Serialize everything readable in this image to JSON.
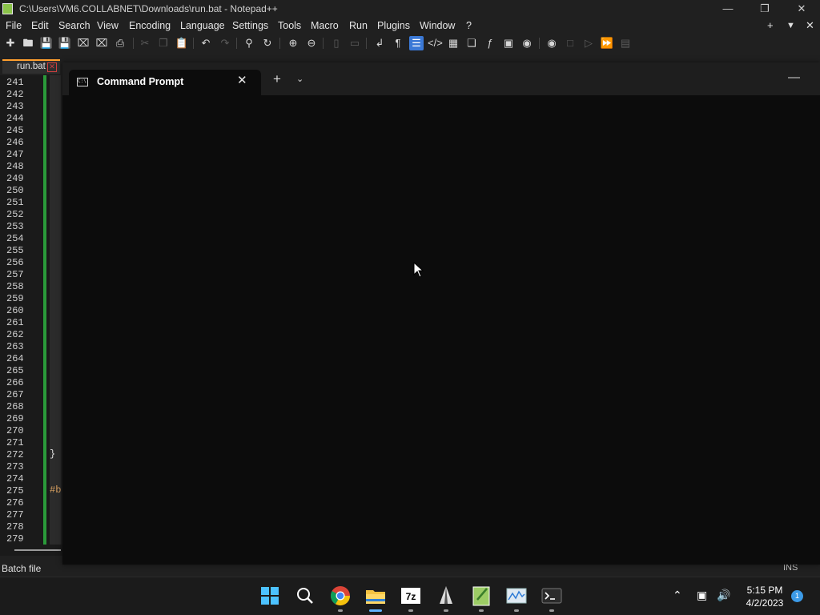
{
  "npp": {
    "window_title": "C:\\Users\\VM6.COLLABNET\\Downloads\\run.bat - Notepad++",
    "menu": [
      "File",
      "Edit",
      "Search",
      "View",
      "Encoding",
      "Language",
      "Settings",
      "Tools",
      "Macro",
      "Run",
      "Plugins",
      "Window",
      "?"
    ],
    "menu_right": [
      "+",
      "▼",
      "✕"
    ],
    "file_tab": "run.bat",
    "line_numbers": [
      "241",
      "242",
      "243",
      "244",
      "245",
      "246",
      "247",
      "248",
      "249",
      "250",
      "251",
      "252",
      "253",
      "254",
      "255",
      "256",
      "257",
      "258",
      "259",
      "260",
      "261",
      "262",
      "263",
      "264",
      "265",
      "266",
      "267",
      "268",
      "269",
      "270",
      "271",
      "272",
      "273",
      "274",
      "275",
      "276",
      "277",
      "278",
      "279"
    ],
    "code_fragments": {
      "brace": "}",
      "hash": "#b"
    },
    "status_left": "Batch file",
    "status_mode": "INS"
  },
  "terminal": {
    "tab_title": "Command Prompt",
    "new_tab": "+",
    "dropdown": "⌄",
    "minimize": "—",
    "close_tab": "✕"
  },
  "taskbar": {
    "time": "5:15 PM",
    "date": "4/2/2023",
    "notification_count": "1",
    "apps": [
      "start-icon",
      "search-icon",
      "chrome-icon",
      "file-explorer-icon",
      "7zip-icon",
      "inkscape-icon",
      "notepadpp-icon",
      "resource-monitor-icon",
      "terminal-icon"
    ]
  },
  "colors": {
    "accent": "#3b79d6",
    "fold_bar": "#2a9a3a",
    "tab_accent": "#ff9f2e",
    "terminal_bg": "#0c0c0c"
  }
}
